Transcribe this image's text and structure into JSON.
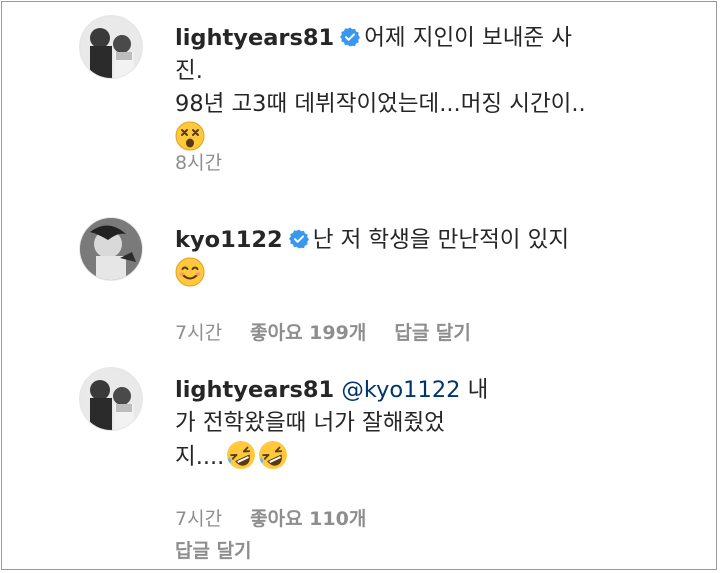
{
  "comments": [
    {
      "username": "lightyears81",
      "verified": true,
      "text_lines": [
        "어제 지인이 보내준 사진.",
        "98년 고3때 데뷔작이었는데...머징 시간이.."
      ],
      "emojis": [
        "dizzy-face"
      ],
      "time": "8시간"
    },
    {
      "username": "kyo1122",
      "verified": true,
      "text_lines": [
        "난 저 학생을 만난적이 있지"
      ],
      "emojis": [
        "smiling-face"
      ],
      "time": "7시간",
      "likes": "좋아요 199개",
      "reply": "답글 달기"
    },
    {
      "username": "lightyears81",
      "verified": false,
      "mention": "@kyo1122",
      "text_lines": [
        "내",
        "가 전학왔을때 너가 잘해줬었",
        "지...."
      ],
      "emojis": [
        "rolling-laughing-face",
        "rolling-laughing-face"
      ],
      "time": "7시간",
      "likes": "좋아요 110개",
      "reply": "답글 달기"
    }
  ],
  "colors": {
    "text": "#262626",
    "meta": "#8e8e8e",
    "verified": "#3897f0",
    "mention": "#003569",
    "emoji": "#ffc83d"
  }
}
